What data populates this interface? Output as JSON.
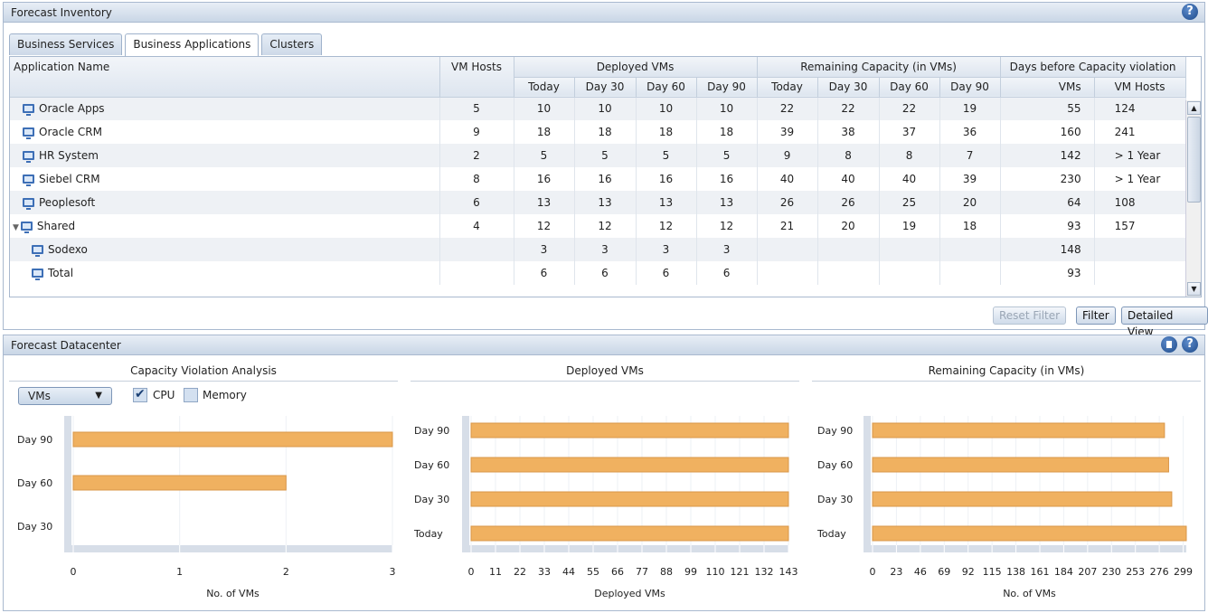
{
  "inventory": {
    "title": "Forecast Inventory",
    "tabs": [
      "Business Services",
      "Business Applications",
      "Clusters"
    ],
    "active_tab": "Business Applications",
    "headers": {
      "app_name": "Application Name",
      "vm_hosts": "VM Hosts",
      "deployed": "Deployed VMs",
      "remaining": "Remaining Capacity (in VMs)",
      "days_before": "Days before Capacity violation",
      "today": "Today",
      "day30": "Day 30",
      "day60": "Day 60",
      "day90": "Day 90",
      "vms": "VMs",
      "vmhosts": "VM Hosts"
    },
    "rows": [
      {
        "name": "Oracle Apps",
        "hosts": "5",
        "d0": "10",
        "d30": "10",
        "d60": "10",
        "d90": "10",
        "r0": "22",
        "r30": "22",
        "r60": "22",
        "r90": "19",
        "vms": "55",
        "vmh": "124"
      },
      {
        "name": "Oracle CRM",
        "hosts": "9",
        "d0": "18",
        "d30": "18",
        "d60": "18",
        "d90": "18",
        "r0": "39",
        "r30": "38",
        "r60": "37",
        "r90": "36",
        "vms": "160",
        "vmh": "241"
      },
      {
        "name": "HR System",
        "hosts": "2",
        "d0": "5",
        "d30": "5",
        "d60": "5",
        "d90": "5",
        "r0": "9",
        "r30": "8",
        "r60": "8",
        "r90": "7",
        "vms": "142",
        "vmh": "> 1 Year"
      },
      {
        "name": "Siebel CRM",
        "hosts": "8",
        "d0": "16",
        "d30": "16",
        "d60": "16",
        "d90": "16",
        "r0": "40",
        "r30": "40",
        "r60": "40",
        "r90": "39",
        "vms": "230",
        "vmh": "> 1 Year"
      },
      {
        "name": "Peoplesoft",
        "hosts": "6",
        "d0": "13",
        "d30": "13",
        "d60": "13",
        "d90": "13",
        "r0": "26",
        "r30": "26",
        "r60": "25",
        "r90": "20",
        "vms": "64",
        "vmh": "108"
      },
      {
        "name": "Shared",
        "hosts": "4",
        "d0": "12",
        "d30": "12",
        "d60": "12",
        "d90": "12",
        "r0": "21",
        "r30": "20",
        "r60": "19",
        "r90": "18",
        "vms": "93",
        "vmh": "157"
      },
      {
        "name": "Sodexo",
        "hosts": "",
        "d0": "3",
        "d30": "3",
        "d60": "3",
        "d90": "3",
        "r0": "",
        "r30": "",
        "r60": "",
        "r90": "",
        "vms": "148",
        "vmh": ""
      },
      {
        "name": "Total",
        "hosts": "",
        "d0": "6",
        "d30": "6",
        "d60": "6",
        "d90": "6",
        "r0": "",
        "r30": "",
        "r60": "",
        "r90": "",
        "vms": "93",
        "vmh": ""
      }
    ],
    "buttons": {
      "reset": "Reset Filter",
      "filter": "Filter",
      "detailed": "Detailed View"
    }
  },
  "datacenter": {
    "title": "Forecast Datacenter",
    "dropdown_value": "VMs",
    "cpu_label": "CPU",
    "memory_label": "Memory",
    "cpu_checked": true,
    "memory_checked": false
  },
  "colors": {
    "bar": "#f0b160",
    "bar_edge": "#d9974a",
    "axis_band": "#d7dee8"
  },
  "chart_data": [
    {
      "type": "bar",
      "title": "Capacity Violation Analysis",
      "xlabel": "No. of VMs",
      "categories": [
        "Day 90",
        "Day 60",
        "Day 30"
      ],
      "values": [
        3,
        2,
        0
      ],
      "xlim": [
        0,
        3
      ],
      "ticks": [
        0,
        1,
        2,
        3
      ]
    },
    {
      "type": "bar",
      "title": "Deployed VMs",
      "xlabel": "Deployed VMs",
      "categories": [
        "Day 90",
        "Day 60",
        "Day 30",
        "Today"
      ],
      "values": [
        143,
        143,
        143,
        143
      ],
      "xlim": [
        0,
        143
      ],
      "ticks": [
        0,
        11,
        22,
        33,
        44,
        55,
        66,
        77,
        88,
        99,
        110,
        121,
        132,
        143
      ]
    },
    {
      "type": "bar",
      "title": "Remaining Capacity (in VMs)",
      "xlabel": "No. of VMs",
      "categories": [
        "Day 90",
        "Day 60",
        "Day 30",
        "Today"
      ],
      "values": [
        281,
        285,
        288,
        302
      ],
      "xlim": [
        0,
        302
      ],
      "ticks": [
        0,
        23,
        46,
        69,
        92,
        115,
        138,
        161,
        184,
        207,
        230,
        253,
        276,
        299
      ]
    }
  ]
}
